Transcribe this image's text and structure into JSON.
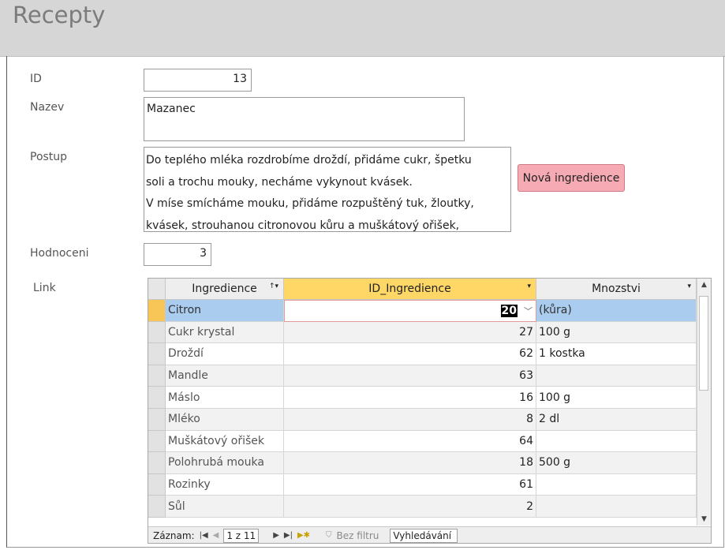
{
  "form": {
    "title": "Recepty",
    "labels": {
      "id": "ID",
      "nazev": "Nazev",
      "postup": "Postup",
      "hodnoceni": "Hodnoceni",
      "link": "Link"
    },
    "values": {
      "id": "13",
      "nazev": "Mazanec",
      "postup_lines": [
        "Do teplého mléka rozdrobíme droždí, přidáme cukr, špetku",
        "soli a trochu mouky, necháme vykynout kvásek.",
        "V míse smícháme mouku, přidáme rozpuštěný tuk, žloutky,",
        "kvásek, strouhanou citronovou kůru a muškátový ořišek,"
      ],
      "hodnoceni": "3"
    },
    "new_ingredient_button": "Nová ingredience"
  },
  "subform": {
    "headers": [
      "Ingredience",
      "ID_Ingredience",
      "Mnozstvi"
    ],
    "rows": [
      {
        "ingredience": "Citron",
        "id": "20",
        "mnozstvi": "(kůra)"
      },
      {
        "ingredience": "Cukr krystal",
        "id": "27",
        "mnozstvi": "100 g"
      },
      {
        "ingredience": "Droždí",
        "id": "62",
        "mnozstvi": "1 kostka"
      },
      {
        "ingredience": "Mandle",
        "id": "63",
        "mnozstvi": ""
      },
      {
        "ingredience": "Máslo",
        "id": "16",
        "mnozstvi": "100 g"
      },
      {
        "ingredience": "Mléko",
        "id": "8",
        "mnozstvi": "2 dl"
      },
      {
        "ingredience": "Muškátový ořišek",
        "id": "64",
        "mnozstvi": ""
      },
      {
        "ingredience": "Polohrubá mouka",
        "id": "18",
        "mnozstvi": "500 g"
      },
      {
        "ingredience": "Rozinky",
        "id": "61",
        "mnozstvi": ""
      },
      {
        "ingredience": "Sůl",
        "id": "2",
        "mnozstvi": ""
      }
    ],
    "nav": {
      "label": "Záznam:",
      "position": "1 z 11",
      "filter": "Bez filtru",
      "search": "Vyhledávání"
    }
  },
  "colors": {
    "header_bg": "#d6d6d6",
    "button_bg": "#f6aab3",
    "active_column": "#ffd766",
    "selected_row": "#a9ccef"
  }
}
